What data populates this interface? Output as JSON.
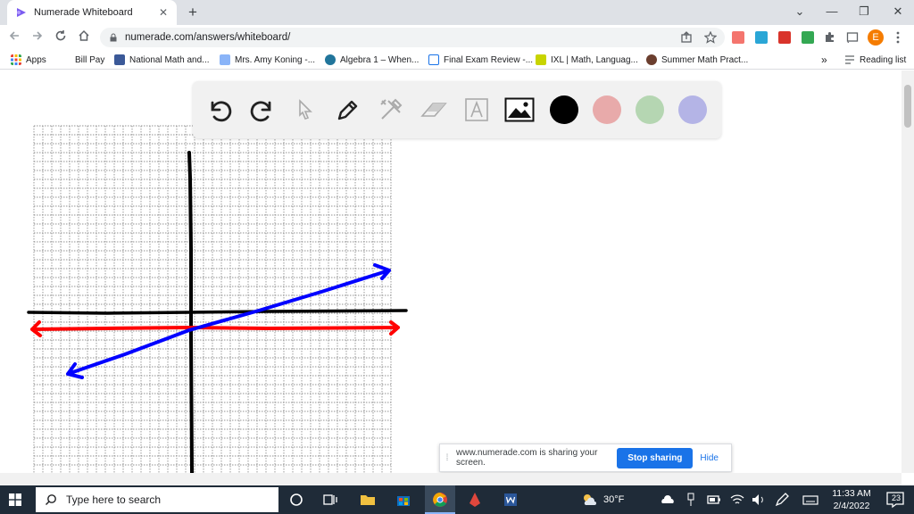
{
  "browser": {
    "tab_title": "Numerade Whiteboard",
    "tab_close": "✕",
    "new_tab": "+",
    "url": "numerade.com/answers/whiteboard/",
    "profile_initial": "E",
    "min": "⌄",
    "minimize": "—",
    "restore": "❐",
    "close": "✕"
  },
  "bookmarks": {
    "apps": "Apps",
    "items": [
      "Bill Pay",
      "National Math and...",
      "Mrs. Amy Koning -...",
      "Algebra 1 – When...",
      "Final Exam Review -...",
      "IXL | Math, Languag...",
      "Summer Math Pract..."
    ],
    "more": "»",
    "reading_list": "Reading list"
  },
  "whiteboard": {
    "colors": {
      "black": "#000000",
      "red": "#e8aaaa",
      "green": "#b5d6b2",
      "blue": "#b4b4e6"
    },
    "axis_color": "#000000",
    "line1_color": "#ff0000",
    "line2_color": "#0000ff"
  },
  "share_bar": {
    "message": "www.numerade.com is sharing your screen.",
    "stop": "Stop sharing",
    "hide": "Hide"
  },
  "taskbar": {
    "search_placeholder": "Type here to search",
    "weather": "30°F",
    "time": "11:33 AM",
    "date": "2/4/2022",
    "notif_count": "23"
  }
}
